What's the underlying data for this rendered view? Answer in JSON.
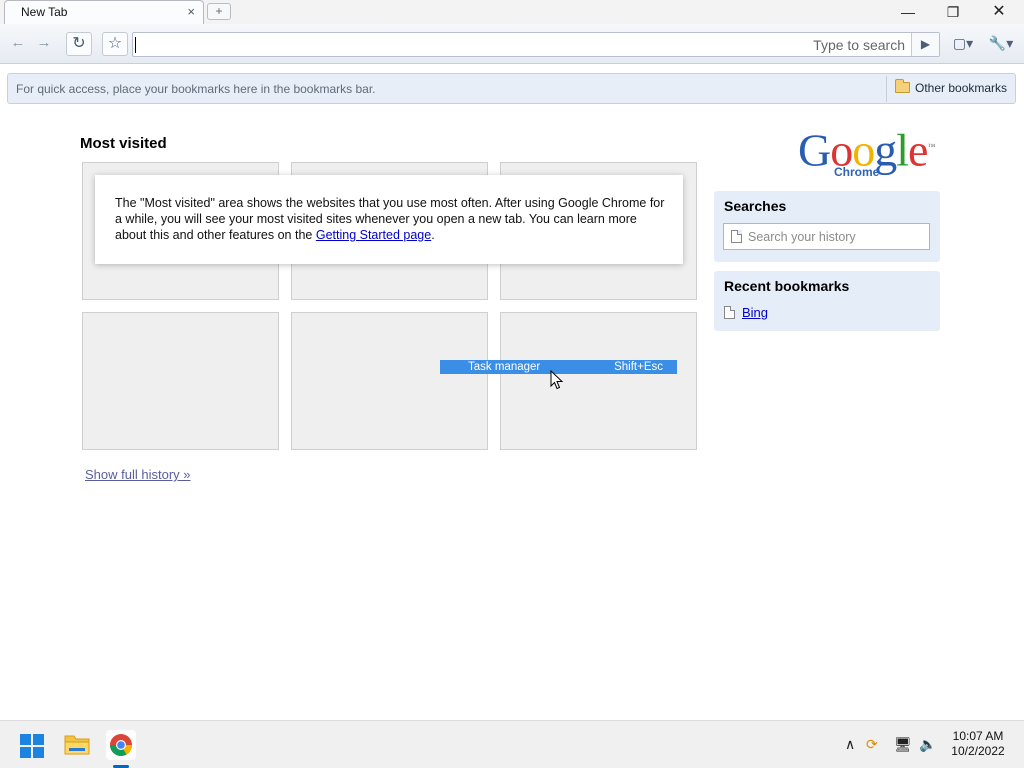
{
  "window": {
    "tab_title": "New Tab",
    "tab_close": "×",
    "new_tab": "+",
    "minimize": "—",
    "restore": "❐",
    "close": "✕"
  },
  "toolbar": {
    "back": "←",
    "forward": "→",
    "reload": "↻",
    "star": "☆",
    "omnibox_value": "",
    "search_hint": "Type to search",
    "go": "▶",
    "page_menu": "▢▾",
    "tools_menu": "🔧▾"
  },
  "bookmarks_bar": {
    "hint": "For quick access, place your bookmarks here in the bookmarks bar.",
    "other_bookmarks": "Other bookmarks"
  },
  "most_visited": {
    "title": "Most visited",
    "notice_text": "The \"Most visited\" area shows the websites that you use most often. After using Google Chrome for a while, you will see your most visited sites whenever you open a new tab. You can learn more about this and other features on the ",
    "notice_link": "Getting Started page",
    "notice_end": ".",
    "show_full_history": "Show full history »"
  },
  "logo": {
    "word": [
      "G",
      "o",
      "o",
      "g",
      "l",
      "e"
    ],
    "sub": "Chrome",
    "tm": "™"
  },
  "searches": {
    "title": "Searches",
    "placeholder": "Search your history"
  },
  "recent_bookmarks": {
    "title": "Recent bookmarks",
    "items": [
      {
        "label": "Bing"
      }
    ]
  },
  "context_item": {
    "label": "Task manager",
    "shortcut": "Shift+Esc"
  },
  "taskbar": {
    "time": "10:07 AM",
    "date": "10/2/2022",
    "tray_chevron": "∧",
    "tray_update": "⟳",
    "tray_network": "🖥",
    "tray_volume": "🔈"
  },
  "colors": {
    "accent": "#3a8ee6",
    "panel": "#e5edf9",
    "taskbar_indicator": "#0067c0"
  }
}
